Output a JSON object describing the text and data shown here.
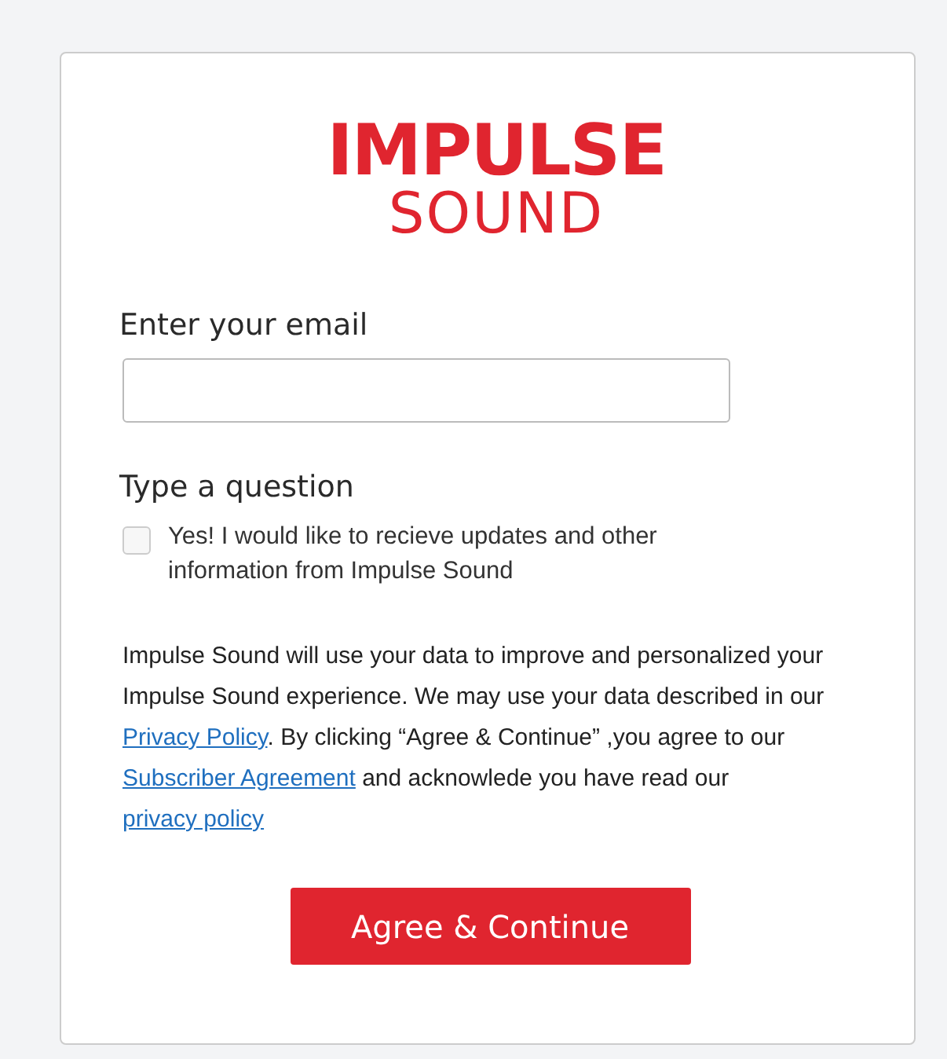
{
  "logo": {
    "line_1": "IMPULSE",
    "line_2": "SOUND"
  },
  "email": {
    "label": "Enter your email"
  },
  "question": {
    "label": "Type a question"
  },
  "consent": {
    "text": "Yes! I would like to recieve updates and other information from Impulse Sound",
    "checked": false
  },
  "notice": [
    {
      "kind": "text",
      "text": "Impulse Sound will use your data to improve and personalized your Impulse Sound experience. We may use your data described in our "
    },
    {
      "kind": "link",
      "text": "Privacy Policy"
    },
    {
      "kind": "text",
      "text": ". By clicking “Agree & Continue” ,you agree to our "
    },
    {
      "kind": "link",
      "text": "Subscriber Agreement"
    },
    {
      "kind": "text",
      "text": " and acknowlede you have read our "
    },
    {
      "kind": "link",
      "text": "privacy policy"
    }
  ],
  "button": "Agree & Continue"
}
